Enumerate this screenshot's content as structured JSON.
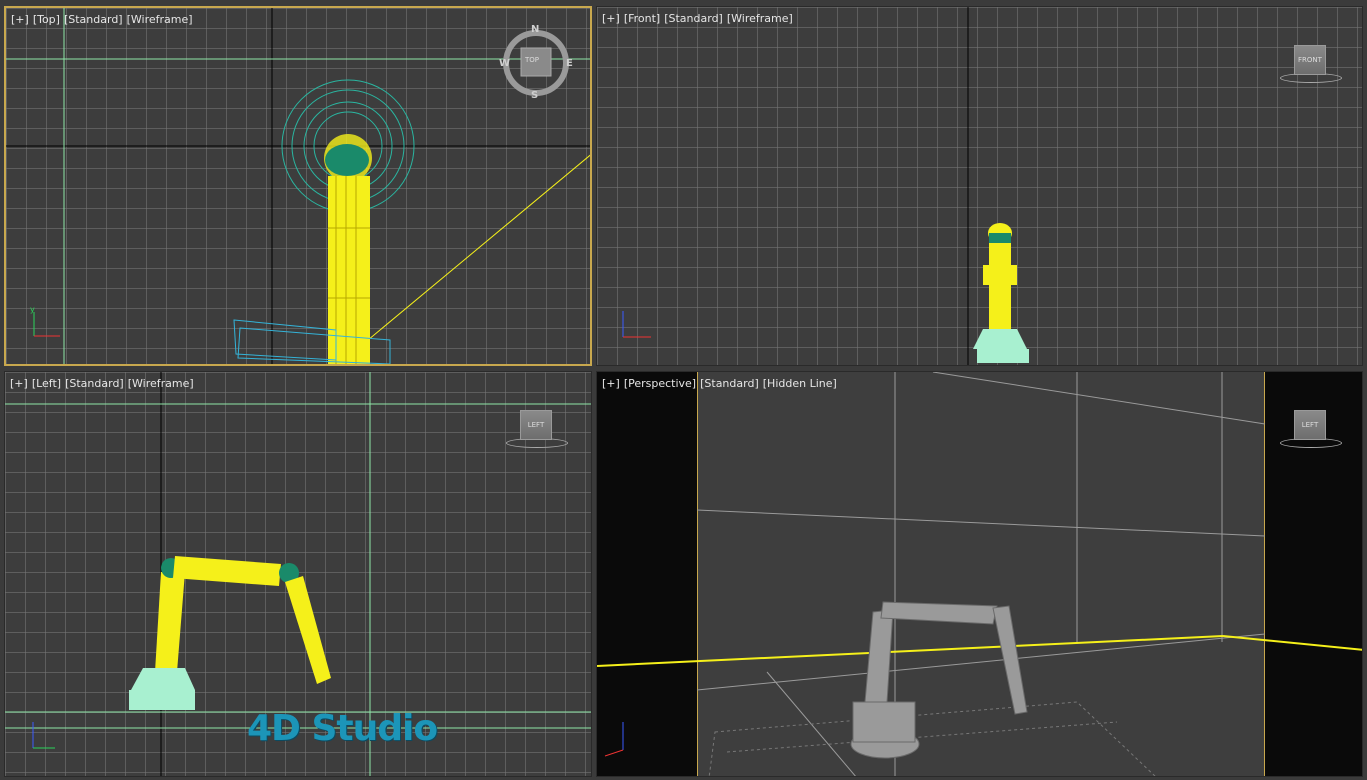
{
  "viewports": {
    "top": {
      "items": [
        "[+]",
        "[Top]",
        "[Standard]",
        "[Wireframe]"
      ],
      "cube_label": "TOP",
      "compass": {
        "n": "N",
        "s": "S",
        "e": "E",
        "w": "W"
      }
    },
    "front": {
      "items": [
        "[+]",
        "[Front]",
        "[Standard]",
        "[Wireframe]"
      ],
      "cube_label": "FRONT"
    },
    "left": {
      "items": [
        "[+]",
        "[Left]",
        "[Standard]",
        "[Wireframe]"
      ],
      "cube_label": "LEFT"
    },
    "perspective": {
      "items": [
        "[+]",
        "[Perspective]",
        "[Standard]",
        "[Hidden Line]"
      ],
      "cube_label": "LEFT"
    }
  },
  "watermark": "4D Studio",
  "axis": {
    "x": "x",
    "y": "y",
    "z": "z"
  },
  "colors": {
    "active_border": "#c8a84e",
    "selected_wire": "#f5f01a",
    "teal_wire": "#2ab5a0",
    "grid": "#7a7a7a"
  }
}
